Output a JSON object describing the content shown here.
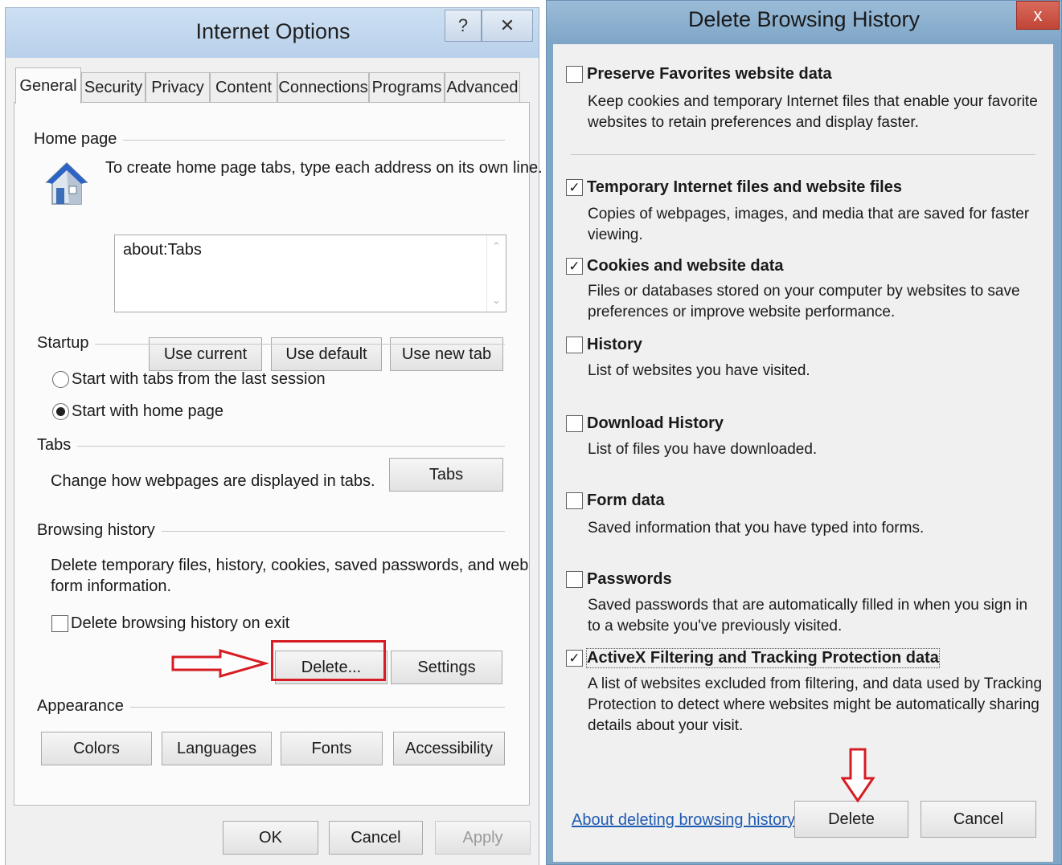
{
  "internet_options": {
    "title": "Internet Options",
    "help_glyph": "?",
    "close_glyph": "✕",
    "tabs": [
      "General",
      "Security",
      "Privacy",
      "Content",
      "Connections",
      "Programs",
      "Advanced"
    ],
    "home_page": {
      "label": "Home page",
      "instruction": "To create home page tabs, type each address on its own line.",
      "value": "about:Tabs",
      "buttons": [
        "Use current",
        "Use default",
        "Use new tab"
      ]
    },
    "startup": {
      "label": "Startup",
      "options": [
        "Start with tabs from the last session",
        "Start with home page"
      ],
      "selected_index": 1
    },
    "tabs_section": {
      "label": "Tabs",
      "description": "Change how webpages are displayed in tabs.",
      "button": "Tabs"
    },
    "browsing_history": {
      "label": "Browsing history",
      "description_line1": "Delete temporary files, history, cookies, saved passwords, and web",
      "description_line2": "form information.",
      "checkbox_label": "Delete browsing history on exit",
      "checkbox_checked": false,
      "delete_button": "Delete...",
      "settings_button": "Settings"
    },
    "appearance": {
      "label": "Appearance",
      "buttons": [
        "Colors",
        "Languages",
        "Fonts",
        "Accessibility"
      ]
    },
    "footer": {
      "ok": "OK",
      "cancel": "Cancel",
      "apply": "Apply"
    }
  },
  "delete_browsing_history": {
    "title": "Delete Browsing History",
    "close_glyph": "x",
    "options": [
      {
        "title": "Preserve Favorites website data",
        "checked": false,
        "desc_lines": [
          "Keep cookies and temporary Internet files that enable your favorite",
          "websites to retain preferences and display faster."
        ]
      },
      {
        "title": "Temporary Internet files and website files",
        "checked": true,
        "desc_lines": [
          "Copies of webpages, images, and media that are saved for faster",
          "viewing."
        ]
      },
      {
        "title": "Cookies and website data",
        "checked": true,
        "desc_lines": [
          "Files or databases stored on your computer by websites to save",
          "preferences or improve website performance."
        ]
      },
      {
        "title": "History",
        "checked": false,
        "desc_lines": [
          "List of websites you have visited."
        ]
      },
      {
        "title": "Download History",
        "checked": false,
        "desc_lines": [
          "List of files you have downloaded."
        ]
      },
      {
        "title": "Form data",
        "checked": false,
        "desc_lines": [
          "Saved information that you have typed into forms."
        ]
      },
      {
        "title": "Passwords",
        "checked": false,
        "desc_lines": [
          "Saved passwords that are automatically filled in when you sign in",
          "to a website you've previously visited."
        ]
      },
      {
        "title": "ActiveX Filtering and Tracking Protection data",
        "checked": true,
        "desc_lines": [
          "A list of websites excluded from filtering, and data used by Tracking",
          "Protection to detect where websites might be automatically sharing",
          "details about your visit."
        ]
      }
    ],
    "about_link": "About deleting browsing history",
    "delete_button": "Delete",
    "cancel_button": "Cancel"
  },
  "annotation": {
    "color": "#d51d23"
  }
}
